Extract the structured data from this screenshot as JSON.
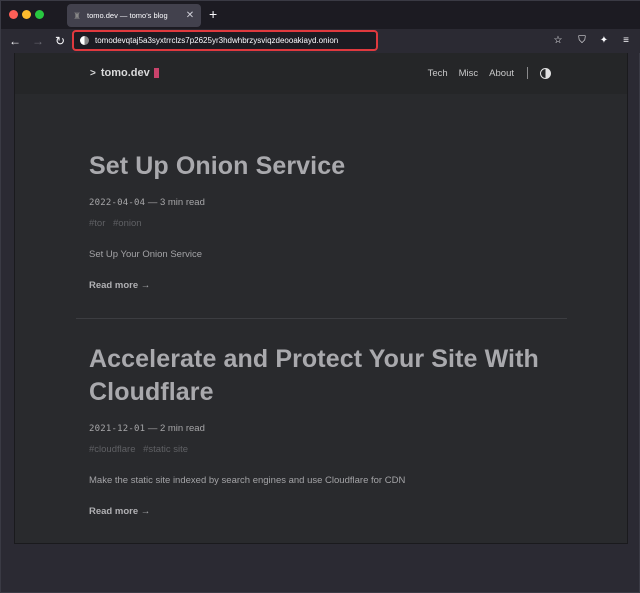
{
  "browser": {
    "tab": {
      "title": "tomo.dev — tomo's blog",
      "close_glyph": "✕"
    },
    "new_tab_glyph": "+",
    "nav": {
      "back_glyph": "←",
      "forward_glyph": "→",
      "reload_glyph": "↻"
    },
    "url": "tomodevqtaj5a3syxtrrclzs7p2625yr3hdwhbrzysviqzdeooakiayd.onion",
    "toolbar_icons": {
      "star": "☆",
      "shield": "⛉",
      "extension": "✦",
      "menu": "≡"
    }
  },
  "site": {
    "logo_prompt": ">",
    "logo_text": "tomo.dev",
    "nav": [
      "Tech",
      "Misc",
      "About"
    ]
  },
  "posts": [
    {
      "title": "Set Up Onion Service",
      "date": "2022-04-04",
      "read_time": "— 3 min read",
      "tags": [
        "#tor",
        "#onion"
      ],
      "description": "Set Up Your Onion Service",
      "read_more": "Read more →"
    },
    {
      "title": "Accelerate and Protect Your Site With Cloudflare",
      "date": "2021-12-01",
      "read_time": "— 2 min read",
      "tags": [
        "#cloudflare",
        "#static site"
      ],
      "description": "Make the static site indexed by search engines and use Cloudflare for CDN",
      "read_more": "Read more →"
    }
  ]
}
